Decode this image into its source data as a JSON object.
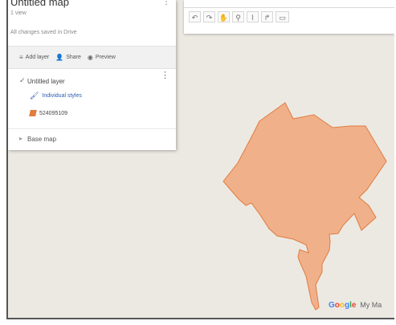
{
  "map": {
    "title": "Untitled map",
    "views": "1 view",
    "save_status": "All changes saved in Drive",
    "attribution": "Google",
    "attribution_product": "My Ma",
    "feature_fill": "#f0b08a",
    "feature_stroke": "#e07d3f",
    "map_background": "#ece9e3"
  },
  "actions": {
    "add_layer": "Add layer",
    "share": "Share",
    "preview": "Preview"
  },
  "layer": {
    "title": "Untitled layer",
    "style": "Individual styles",
    "feature": "524095109"
  },
  "basemap": {
    "label": "Base map"
  },
  "toolbar": {
    "undo": "↶",
    "redo": "↷",
    "pan": "✋",
    "marker": "⚲",
    "draw_line": "⌇",
    "directions": "↱",
    "measure": "▭"
  },
  "icons": {
    "panel_menu": "⋮",
    "layer_menu": "⋮",
    "checkbox": "✓",
    "add_layer": "≡",
    "share": "👤",
    "preview": "◉",
    "style": "🖌",
    "basemap": "▸"
  }
}
